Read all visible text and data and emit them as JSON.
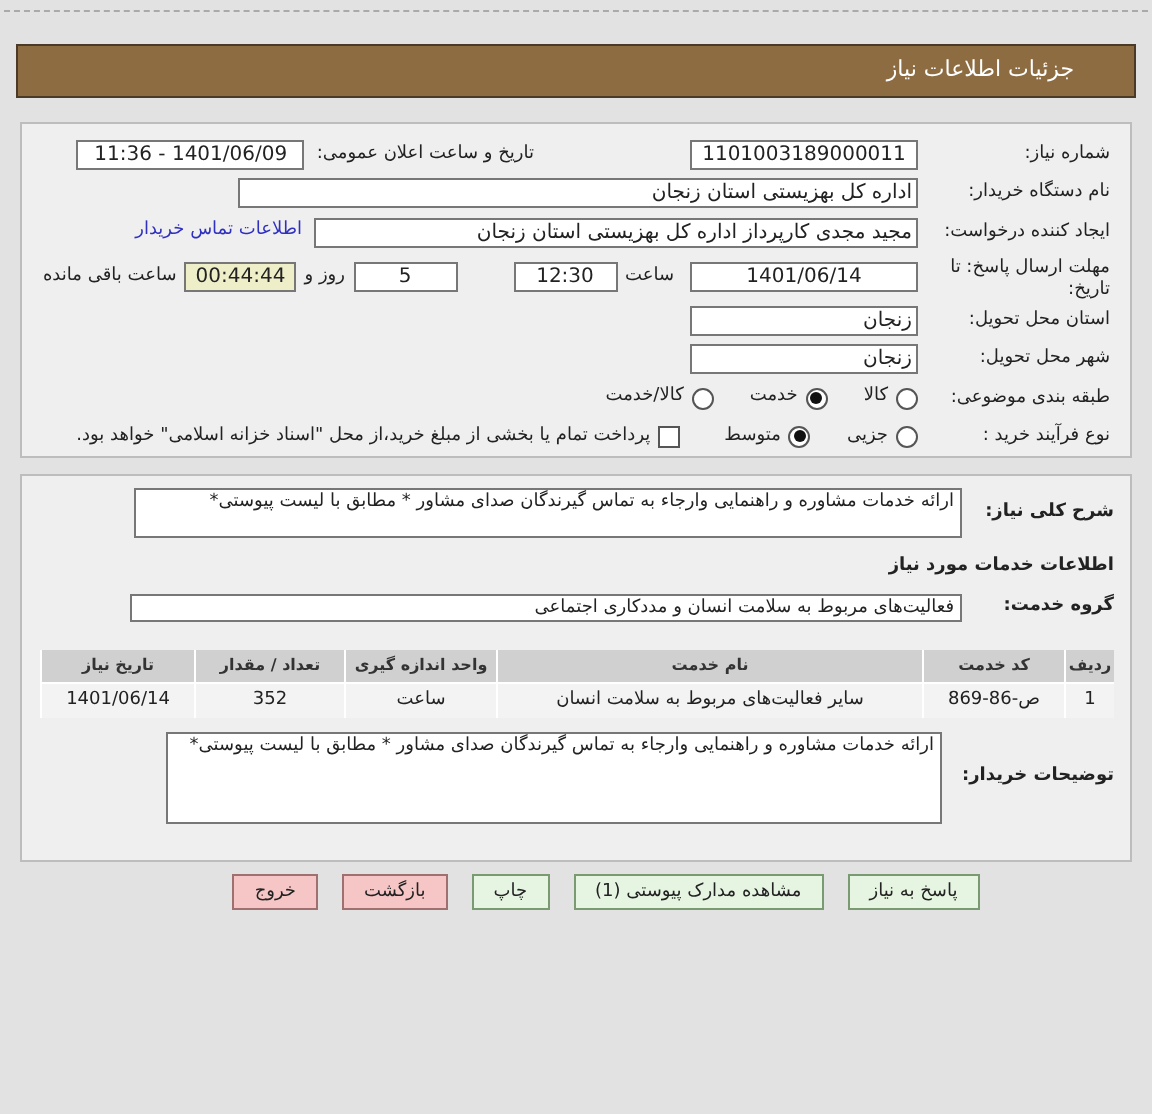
{
  "header": {
    "title": "جزئیات اطلاعات نیاز"
  },
  "details": {
    "need_number": {
      "label": "شماره نیاز:",
      "value": "1101003189000011"
    },
    "announce": {
      "label": "تاریخ و ساعت اعلان عمومی:",
      "value": "1401/06/09 - 11:36"
    },
    "buyer": {
      "label": "نام دستگاه خریدار:",
      "value": "اداره کل بهزیستی استان زنجان"
    },
    "creator": {
      "label": "ایجاد کننده درخواست:",
      "value": "مجید مجدی کارپرداز اداره کل بهزیستی استان زنجان",
      "link": "اطلاعات تماس خریدار"
    },
    "deadline": {
      "label": "مهلت ارسال پاسخ: تا تاریخ:",
      "date": "1401/06/14",
      "time_label": "ساعت",
      "time": "12:30",
      "days": "5",
      "days_label": "روز و",
      "remaining": "00:44:44",
      "remaining_label": "ساعت باقی مانده"
    },
    "province": {
      "label": "استان محل تحویل:",
      "value": "زنجان"
    },
    "city": {
      "label": "شهر محل تحویل:",
      "value": "زنجان"
    },
    "category": {
      "label": "طبقه بندی موضوعی:",
      "options": [
        {
          "label": "کالا",
          "selected": false
        },
        {
          "label": "خدمت",
          "selected": true
        },
        {
          "label": "کالا/خدمت",
          "selected": false
        }
      ]
    },
    "process": {
      "label": "نوع فرآیند خرید :",
      "options": [
        {
          "label": "جزیی",
          "selected": false
        },
        {
          "label": "متوسط",
          "selected": true
        }
      ],
      "payment_note": {
        "text": "پرداخت تمام یا بخشی از مبلغ خرید،از محل \"اسناد خزانه اسلامی\" خواهد بود.",
        "checked": false
      }
    }
  },
  "summary": {
    "label": "شرح کلی نیاز:",
    "value": "ارائه خدمات مشاوره و راهنمایی وارجاء به تماس گیرندگان صدای مشاور * مطابق با لیست پیوستی*"
  },
  "services_heading": "اطلاعات خدمات مورد نیاز",
  "service_group": {
    "label": "گروه خدمت:",
    "value": "فعالیت‌های مربوط به سلامت انسان و مددکاری اجتماعی"
  },
  "table": {
    "columns": [
      "ردیف",
      "کد خدمت",
      "نام خدمت",
      "واحد اندازه گیری",
      "تعداد / مقدار",
      "تاریخ نیاز"
    ],
    "rows": [
      [
        "1",
        "ص-86-869",
        "سایر فعالیت‌های مربوط به سلامت انسان",
        "ساعت",
        "352",
        "1401/06/14"
      ]
    ]
  },
  "buyer_notes": {
    "label": "توضیحات خریدار:",
    "value": "ارائه خدمات مشاوره و راهنمایی وارجاء به تماس گیرندگان صدای مشاور * مطابق با لیست پیوستی*"
  },
  "buttons": [
    {
      "label": "پاسخ به نیاز",
      "kind": "normal"
    },
    {
      "label": "مشاهده مدارک پیوستی (1)",
      "kind": "normal"
    },
    {
      "label": "چاپ",
      "kind": "normal"
    },
    {
      "label": "بازگشت",
      "kind": "danger"
    },
    {
      "label": "خروج",
      "kind": "danger"
    }
  ]
}
